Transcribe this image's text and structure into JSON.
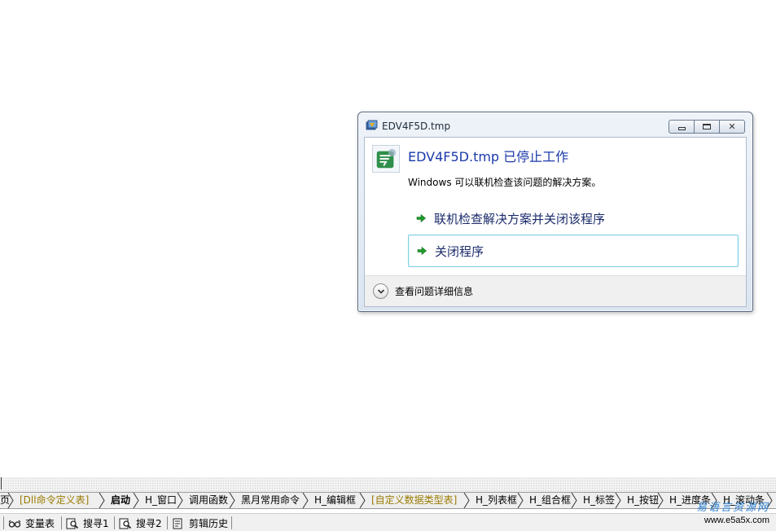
{
  "dialog": {
    "title": "EDV4F5D.tmp",
    "headline": "EDV4F5D.tmp 已停止工作",
    "message": "Windows 可以联机检查该问题的解决方案。",
    "commands": [
      {
        "label": "联机检查解决方案并关闭该程序"
      },
      {
        "label": "关闭程序"
      }
    ],
    "details_label": "查看问题详细信息",
    "close_glyph": "✕"
  },
  "tabs": [
    {
      "label": "页"
    },
    {
      "label": "[Dll命令定义表]"
    },
    {
      "label": "启动"
    },
    {
      "label": "H_窗口"
    },
    {
      "label": "调用函数"
    },
    {
      "label": "黑月常用命令"
    },
    {
      "label": "H_编辑框"
    },
    {
      "label": "[自定义数据类型表]"
    },
    {
      "label": "H_列表框"
    },
    {
      "label": "H_组合框"
    },
    {
      "label": "H_标签"
    },
    {
      "label": "H_按钮"
    },
    {
      "label": "H_进度条"
    },
    {
      "label": "H_滚动条"
    }
  ],
  "statusbar": {
    "items": [
      {
        "label": "变量表",
        "icon": "glasses-icon"
      },
      {
        "label": "搜寻1",
        "icon": "magnifier-document-icon"
      },
      {
        "label": "搜寻2",
        "icon": "magnifier-document-icon"
      },
      {
        "label": "剪辑历史",
        "icon": "clipboard-document-icon"
      }
    ]
  },
  "watermark": {
    "chinese": "易语言资源网",
    "url": "www.e5a5x.com"
  },
  "colors": {
    "headline": "#1c3aa9",
    "arrow_green": "#1f9a2a",
    "focused_border": "#7fd0e6",
    "gold_tab": "#9a7a00",
    "watermark": "#2a7fd0"
  }
}
